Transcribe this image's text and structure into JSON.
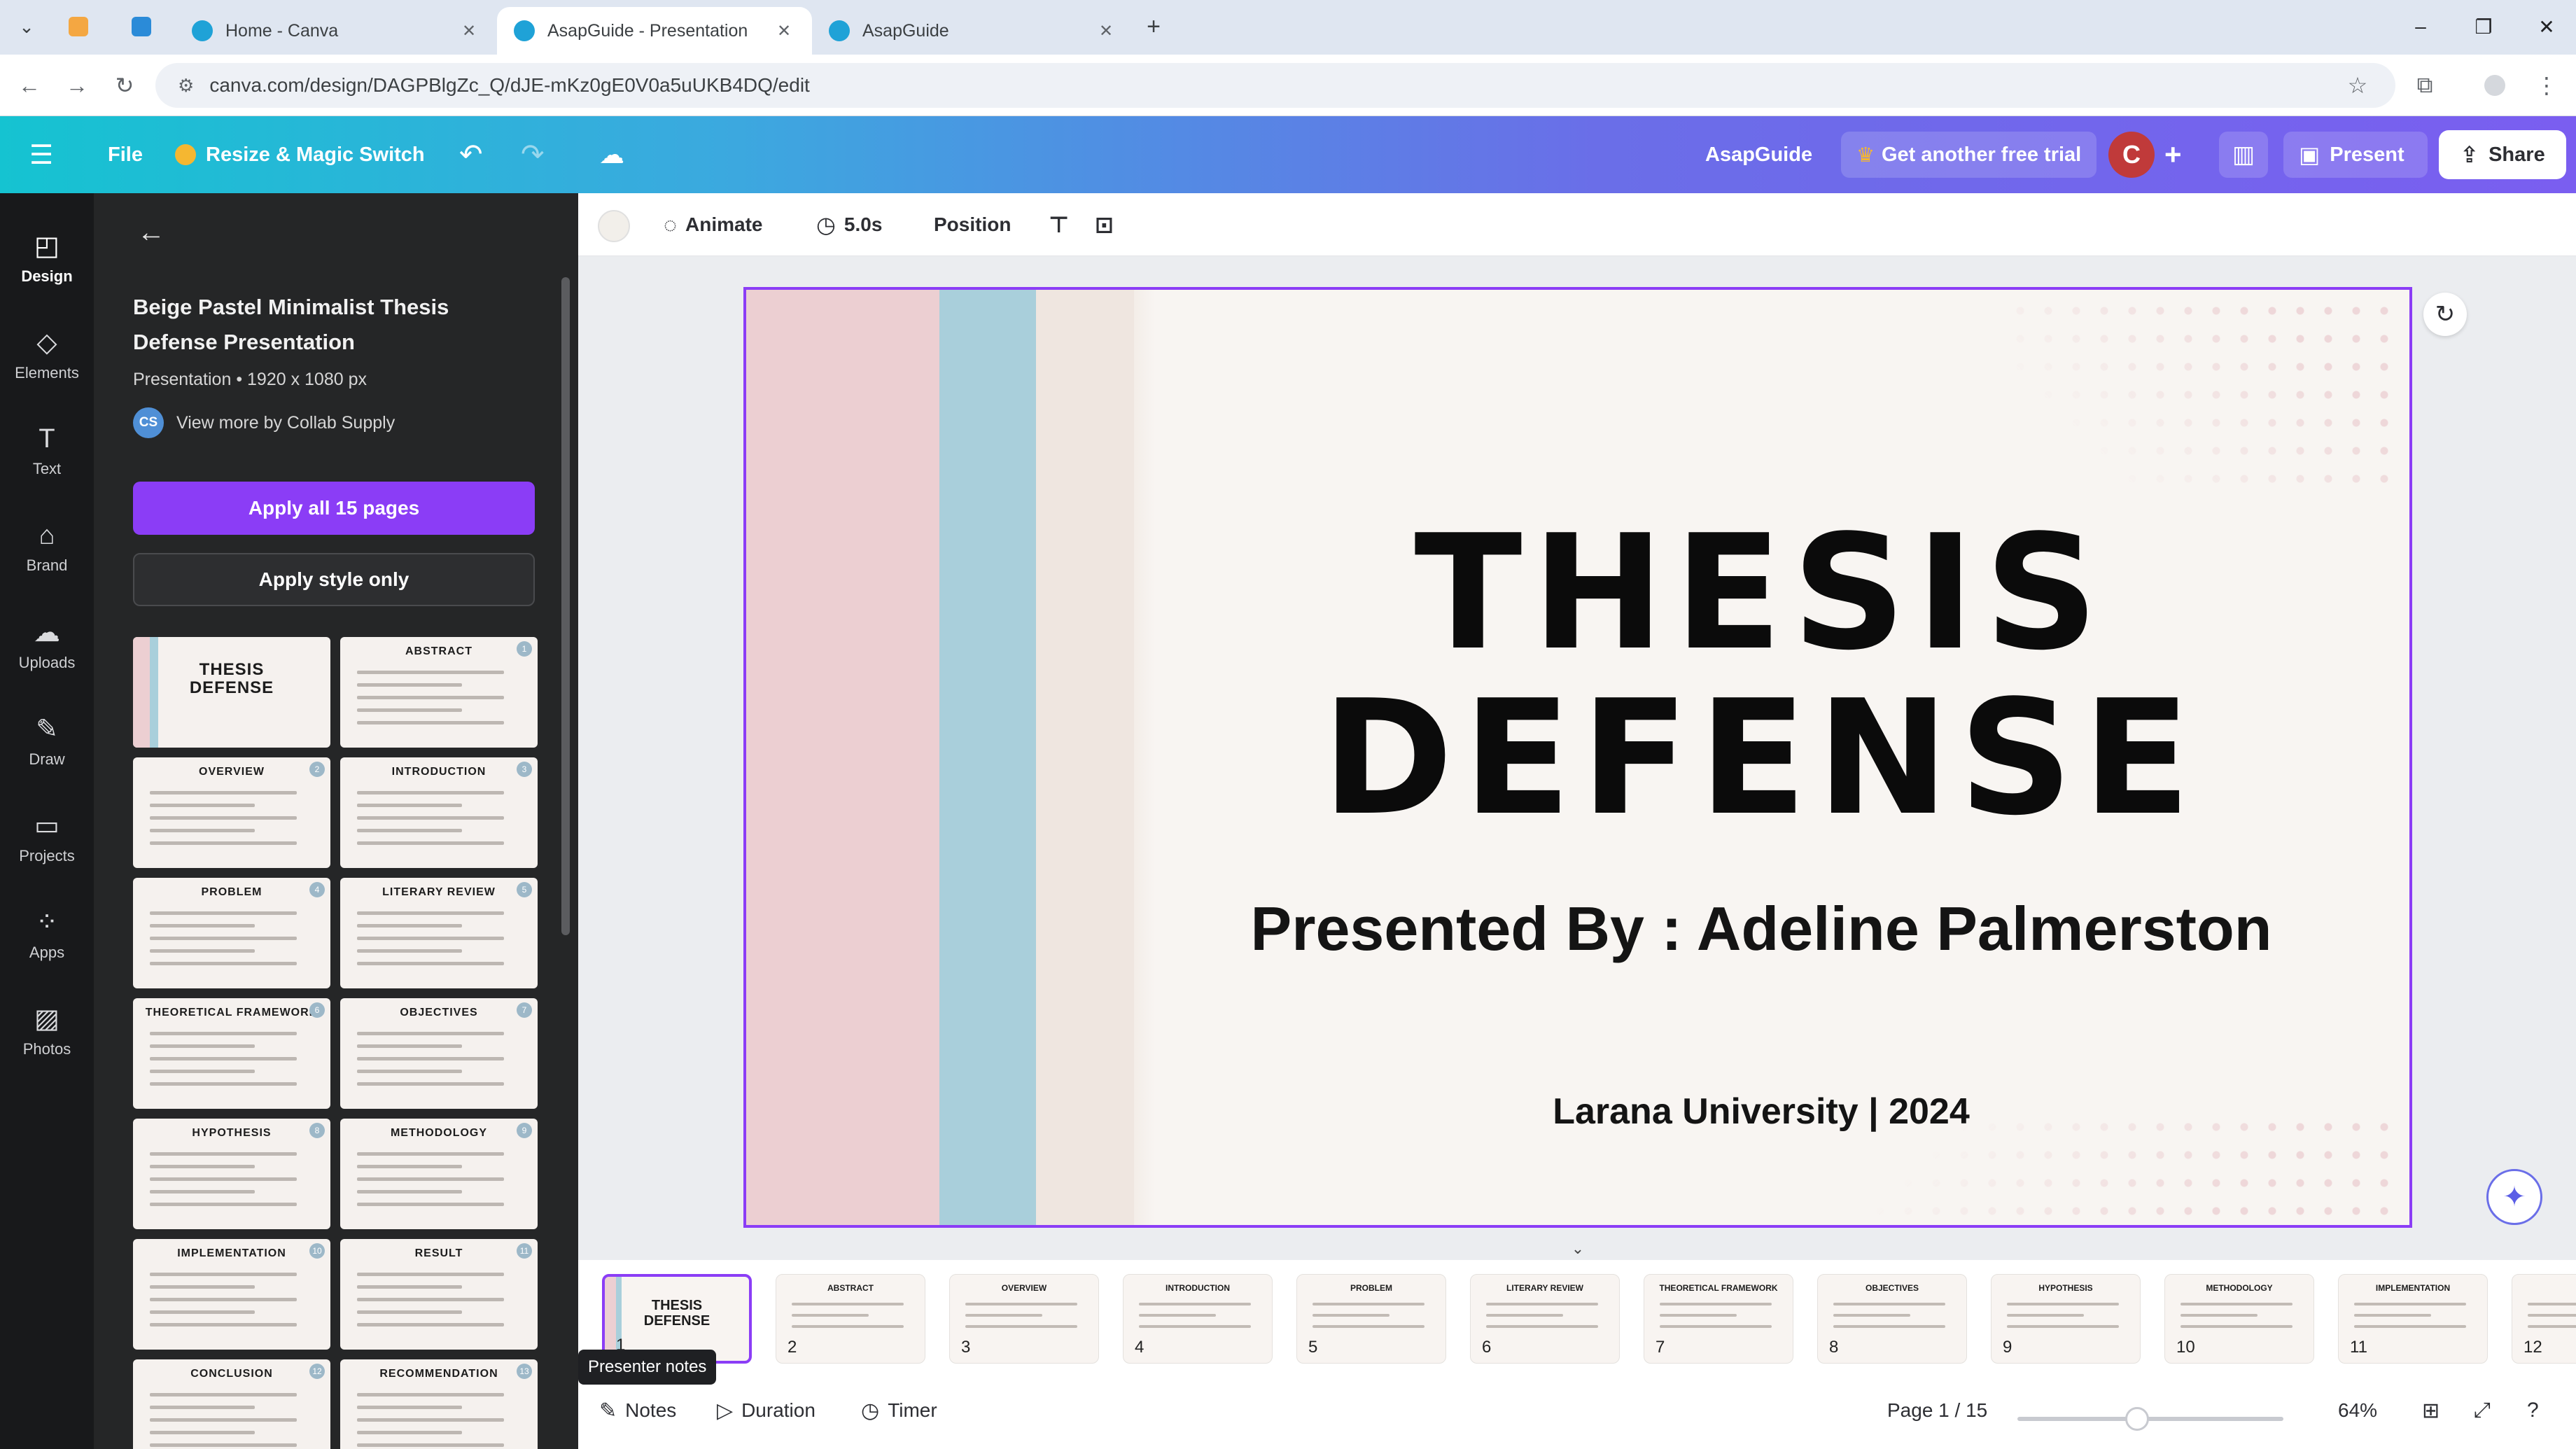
{
  "browser": {
    "tabs": [
      {
        "title": "",
        "favicon_color": "#f4a742",
        "active": false
      },
      {
        "title": "",
        "favicon_color": "#2b8bd8",
        "active": false
      },
      {
        "title": "Home - Canva",
        "favicon_color": "#1fa2d7",
        "active": false
      },
      {
        "title": "AsapGuide - Presentation",
        "favicon_color": "#1fa2d7",
        "active": true
      },
      {
        "title": "AsapGuide",
        "favicon_color": "#1fa2d7",
        "active": false
      }
    ],
    "url": "canva.com/design/DAGPBlgZc_Q/dJE-mKz0gE0V0a5uUKB4DQ/edit"
  },
  "canva_top": {
    "file_label": "File",
    "resize_label": "Resize & Magic Switch",
    "design_name": "AsapGuide",
    "trial_label": "Get another free trial",
    "avatar_letter": "C",
    "present_label": "Present",
    "share_label": "Share"
  },
  "rail": [
    {
      "label": "Design",
      "icon": "design-icon",
      "active": true
    },
    {
      "label": "Elements",
      "icon": "elements-icon",
      "active": false
    },
    {
      "label": "Text",
      "icon": "text-icon",
      "active": false
    },
    {
      "label": "Brand",
      "icon": "brand-icon",
      "active": false
    },
    {
      "label": "Uploads",
      "icon": "uploads-icon",
      "active": false
    },
    {
      "label": "Draw",
      "icon": "draw-icon",
      "active": false
    },
    {
      "label": "Projects",
      "icon": "projects-icon",
      "active": false
    },
    {
      "label": "Apps",
      "icon": "apps-icon",
      "active": false
    },
    {
      "label": "Photos",
      "icon": "photos-icon",
      "active": false
    }
  ],
  "panel": {
    "template_title": "Beige Pastel Minimalist Thesis Defense Presentation",
    "template_meta": "Presentation • 1920 x 1080 px",
    "author_initials": "CS",
    "author_link": "View more by Collab Supply",
    "apply_all_label": "Apply all 15 pages",
    "apply_style_label": "Apply style only",
    "pages": [
      {
        "title": "THESIS DEFENSE",
        "num": ""
      },
      {
        "title": "ABSTRACT",
        "num": "1"
      },
      {
        "title": "OVERVIEW",
        "num": "2"
      },
      {
        "title": "INTRODUCTION",
        "num": "3"
      },
      {
        "title": "PROBLEM",
        "num": "4"
      },
      {
        "title": "LITERARY REVIEW",
        "num": "5"
      },
      {
        "title": "THEORETICAL FRAMEWORK",
        "num": "6"
      },
      {
        "title": "OBJECTIVES",
        "num": "7"
      },
      {
        "title": "HYPOTHESIS",
        "num": "8"
      },
      {
        "title": "METHODOLOGY",
        "num": "9"
      },
      {
        "title": "IMPLEMENTATION",
        "num": "10"
      },
      {
        "title": "RESULT",
        "num": "11"
      },
      {
        "title": "CONCLUSION",
        "num": "12"
      },
      {
        "title": "RECOMMENDATION",
        "num": "13"
      }
    ]
  },
  "toolbar": {
    "animate_label": "Animate",
    "duration_label": "5.0s",
    "position_label": "Position"
  },
  "slide": {
    "title_line1": "THESIS",
    "title_line2": "DEFENSE",
    "presenter": "Presented By : Adeline Palmerston",
    "university": "Larana University | 2024",
    "colors": {
      "pink": "#eccfd2",
      "blue": "#a9cfdb",
      "cream": "#efe6e0",
      "background": "#f8f5f2"
    }
  },
  "strip": [
    {
      "num": "1",
      "title": "THESIS DEFENSE"
    },
    {
      "num": "2",
      "title": "ABSTRACT"
    },
    {
      "num": "3",
      "title": "OVERVIEW"
    },
    {
      "num": "4",
      "title": "INTRODUCTION"
    },
    {
      "num": "5",
      "title": "PROBLEM"
    },
    {
      "num": "6",
      "title": "LITERARY REVIEW"
    },
    {
      "num": "7",
      "title": "THEORETICAL FRAMEWORK"
    },
    {
      "num": "8",
      "title": "OBJECTIVES"
    },
    {
      "num": "9",
      "title": "HYPOTHESIS"
    },
    {
      "num": "10",
      "title": "METHODOLOGY"
    },
    {
      "num": "11",
      "title": "IMPLEMENTATION"
    },
    {
      "num": "12",
      "title": ""
    }
  ],
  "bottom": {
    "tooltip": "Presenter notes",
    "notes_label": "Notes",
    "duration_label": "Duration",
    "timer_label": "Timer",
    "page_indicator": "Page 1 / 15",
    "zoom": "64%",
    "zoom_fraction": 0.45
  },
  "accent_color": "#8b3df6"
}
